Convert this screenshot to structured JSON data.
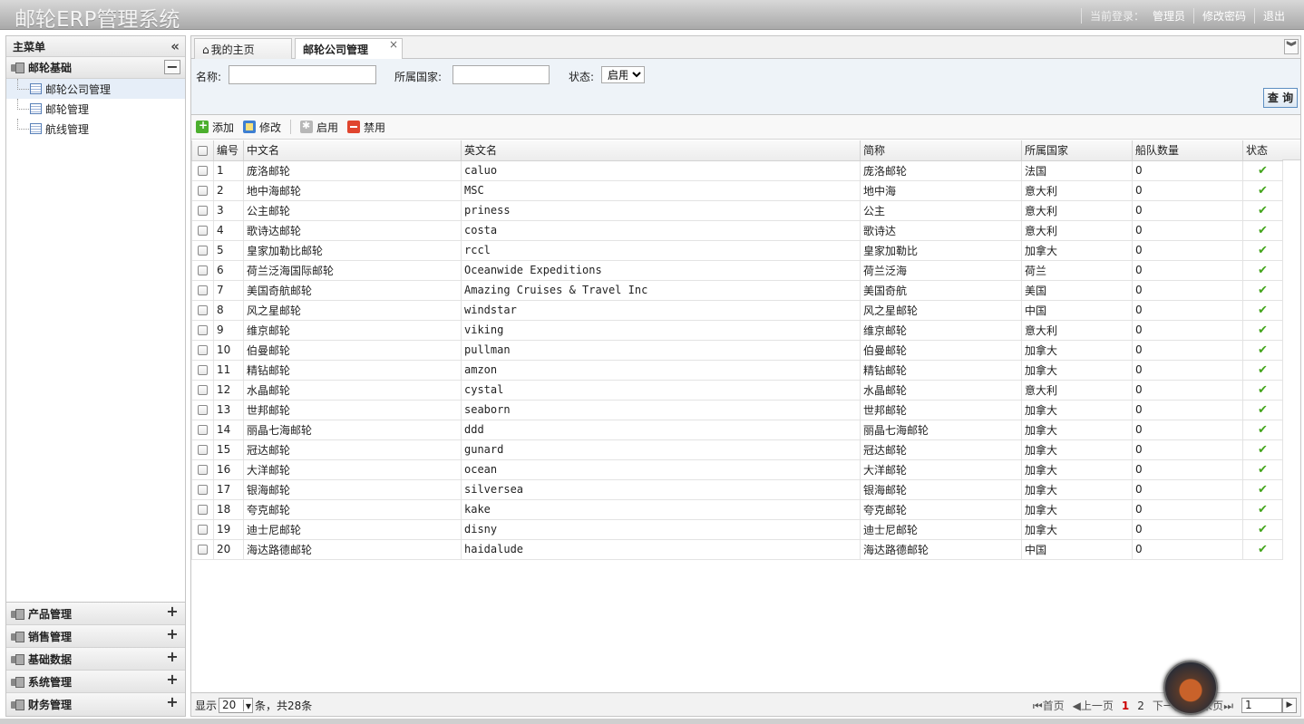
{
  "header": {
    "app_title": "邮轮ERP管理系统",
    "login_label": "当前登录：",
    "login_user": "管理员",
    "change_password": "修改密码",
    "logout": "退出"
  },
  "sidebar": {
    "title": "主菜单",
    "collapse_icon": "«",
    "expanded_group": {
      "label": "邮轮基础",
      "items": [
        "邮轮公司管理",
        "邮轮管理",
        "航线管理"
      ]
    },
    "collapsed_groups": [
      "产品管理",
      "销售管理",
      "基础数据",
      "系统管理",
      "财务管理"
    ]
  },
  "tabs": {
    "home_label": "我的主页",
    "active_label": "邮轮公司管理",
    "close_glyph": "×"
  },
  "search": {
    "name_label": "名称:",
    "name_value": "",
    "country_label": "所属国家:",
    "country_value": "",
    "status_label": "状态:",
    "status_value": "启用",
    "search_button": "查 询"
  },
  "toolbar": {
    "add": "添加",
    "edit": "修改",
    "enable": "启用",
    "disable": "禁用"
  },
  "grid": {
    "columns": [
      "编号",
      "中文名",
      "英文名",
      "简称",
      "所属国家",
      "船队数量",
      "状态"
    ],
    "rows": [
      [
        "1",
        "庞洛邮轮",
        "caluo",
        "庞洛邮轮",
        "法国",
        "0"
      ],
      [
        "2",
        "地中海邮轮",
        "MSC",
        "地中海",
        "意大利",
        "0"
      ],
      [
        "3",
        "公主邮轮",
        "priness",
        "公主",
        "意大利",
        "0"
      ],
      [
        "4",
        "歌诗达邮轮",
        "costa",
        "歌诗达",
        "意大利",
        "0"
      ],
      [
        "5",
        "皇家加勒比邮轮",
        "rccl",
        "皇家加勒比",
        "加拿大",
        "0"
      ],
      [
        "6",
        "荷兰泛海国际邮轮",
        "Oceanwide Expeditions",
        "荷兰泛海",
        "荷兰",
        "0"
      ],
      [
        "7",
        "美国奇航邮轮",
        "Amazing Cruises & Travel Inc",
        "美国奇航",
        "美国",
        "0"
      ],
      [
        "8",
        "风之星邮轮",
        "windstar",
        "风之星邮轮",
        "中国",
        "0"
      ],
      [
        "9",
        "维京邮轮",
        "viking",
        "维京邮轮",
        "意大利",
        "0"
      ],
      [
        "10",
        "伯曼邮轮",
        "pullman",
        "伯曼邮轮",
        "加拿大",
        "0"
      ],
      [
        "11",
        "精钻邮轮",
        "amzon",
        "精钻邮轮",
        "加拿大",
        "0"
      ],
      [
        "12",
        "水晶邮轮",
        "cystal",
        "水晶邮轮",
        "意大利",
        "0"
      ],
      [
        "13",
        "世邦邮轮",
        "seaborn",
        "世邦邮轮",
        "加拿大",
        "0"
      ],
      [
        "14",
        "丽晶七海邮轮",
        "ddd",
        "丽晶七海邮轮",
        "加拿大",
        "0"
      ],
      [
        "15",
        "冠达邮轮",
        "gunard",
        "冠达邮轮",
        "加拿大",
        "0"
      ],
      [
        "16",
        "大洋邮轮",
        "ocean",
        "大洋邮轮",
        "加拿大",
        "0"
      ],
      [
        "17",
        "银海邮轮",
        "silversea",
        "银海邮轮",
        "加拿大",
        "0"
      ],
      [
        "18",
        "夸克邮轮",
        "kake",
        "夸克邮轮",
        "加拿大",
        "0"
      ],
      [
        "19",
        "迪士尼邮轮",
        "disny",
        "迪士尼邮轮",
        "加拿大",
        "0"
      ],
      [
        "20",
        "海达路德邮轮",
        "haidalude",
        "海达路德邮轮",
        "中国",
        "0"
      ]
    ],
    "status_glyph": "✔"
  },
  "pager": {
    "show_label": "显示",
    "page_size": "20",
    "summary": "条，共28条",
    "first": "首页",
    "prev": "上一页",
    "page1": "1",
    "page2": "2",
    "next": "下一页",
    "last": "末页",
    "jump_value": "1"
  },
  "colors": {
    "accent": "#5d8ec1",
    "status_ok": "#44a51d",
    "current_page": "#cc0000"
  }
}
